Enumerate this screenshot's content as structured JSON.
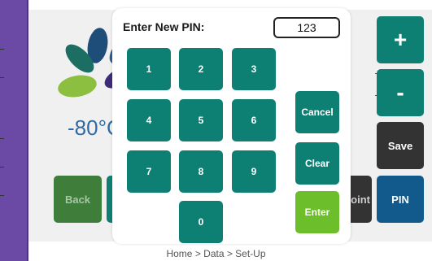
{
  "dialog": {
    "title": "Enter New PIN:",
    "pin_value": "123",
    "keys": [
      "1",
      "2",
      "3",
      "4",
      "5",
      "6",
      "7",
      "8",
      "9",
      "0"
    ],
    "cancel_label": "Cancel",
    "clear_label": "Clear",
    "enter_label": "Enter"
  },
  "background": {
    "temperature": "-80°C",
    "buttons": {
      "plus": "+",
      "minus": "-",
      "save": "Save",
      "pin": "PIN",
      "back": "Back",
      "point_partial": "oint"
    }
  },
  "breadcrumb": "Home > Data > Set-Up",
  "colors": {
    "teal": "#0e7f73",
    "enter_green": "#6cbf2a",
    "purple_bar": "#6b4aa6",
    "pin_blue": "#125a8c"
  }
}
